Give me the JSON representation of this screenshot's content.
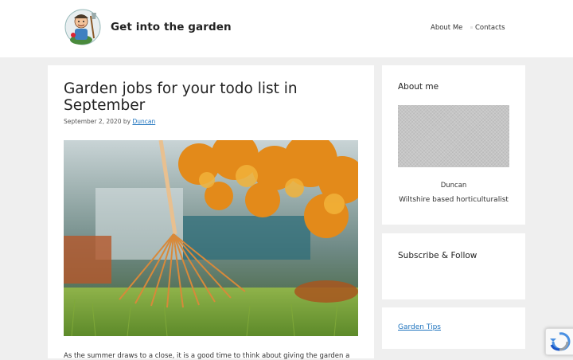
{
  "header": {
    "site_title": "Get into the garden",
    "logo_icon": "gardener-mascot-icon"
  },
  "nav": {
    "items": [
      {
        "label": "About Me"
      },
      {
        "label": "Contacts"
      }
    ]
  },
  "post": {
    "title": "Garden jobs for your todo list in September",
    "date": "September 2, 2020",
    "by": "by",
    "author": "Duncan",
    "hero_image": "rake-on-lawn-autumn-leaves",
    "excerpt": "As the summer draws to a close, it is a good time to think about giving the garden a"
  },
  "sidebar": {
    "about": {
      "title": "About me",
      "name": "Duncan",
      "bio": "Wiltshire based horticulturalist"
    },
    "subscribe": {
      "title": "Subscribe & Follow"
    },
    "categories": {
      "link": "Garden Tips"
    }
  },
  "recaptcha_icon": "recaptcha-icon",
  "colors": {
    "link": "#1e73be",
    "background": "#efefef",
    "card": "#ffffff"
  }
}
